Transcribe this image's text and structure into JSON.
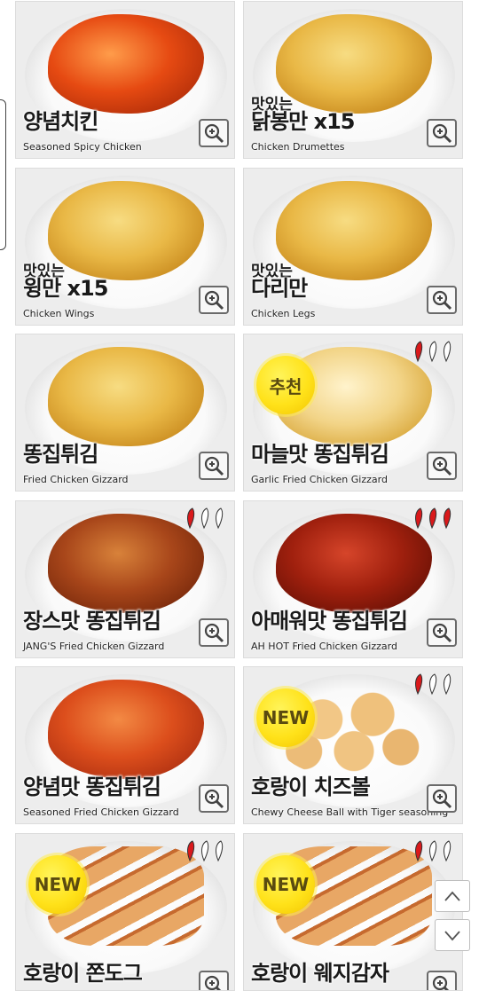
{
  "menu_items": [
    {
      "name_ko": "양념치킨",
      "name_en": "Seasoned Spicy Chicken",
      "pre": ""
    },
    {
      "name_ko": "닭봉만 x15",
      "name_en": "Chicken Drumettes",
      "pre": "맛있는"
    },
    {
      "name_ko": "윙만 x15",
      "name_en": "Chicken Wings",
      "pre": "맛있는"
    },
    {
      "name_ko": "다리만",
      "name_en": "Chicken Legs",
      "pre": "맛있는"
    },
    {
      "name_ko": "똥집튀김",
      "name_en": "Fried Chicken Gizzard",
      "pre": ""
    },
    {
      "name_ko": "마늘맛 똥집튀김",
      "name_en": "Garlic Fried Chicken Gizzard",
      "pre": "",
      "badge": "추천",
      "spice_level": 1
    },
    {
      "name_ko": "장스맛 똥집튀김",
      "name_en": "JANG'S Fried Chicken Gizzard",
      "pre": "",
      "spice_level": 1
    },
    {
      "name_ko": "아매워맛 똥집튀김",
      "name_en": "AH HOT Fried Chicken Gizzard",
      "pre": "",
      "spice_level": 3
    },
    {
      "name_ko": "양념맛 똥집튀김",
      "name_en": "Seasoned Fried Chicken Gizzard",
      "pre": ""
    },
    {
      "name_ko": "호랑이 치즈볼",
      "name_en": "Chewy Cheese Ball with Tiger seasoning",
      "pre": "",
      "badge": "NEW",
      "spice_level": 1
    },
    {
      "name_ko": "호랑이 쫀도그",
      "name_en": "",
      "pre": "",
      "badge": "NEW",
      "spice_level": 1
    },
    {
      "name_ko": "호랑이 웨지감자",
      "name_en": "",
      "pre": "",
      "badge": "NEW",
      "spice_level": 1
    }
  ],
  "icons": {
    "zoom": "zoom-in-magnifier-icon",
    "scroll_up": "chevron-up-icon",
    "scroll_down": "chevron-down-icon",
    "pepper": "chili-pepper-icon"
  },
  "colors": {
    "pepper_hot": "#d9191b",
    "pepper_mild": "#ffffff",
    "badge": "#ffe21a"
  }
}
